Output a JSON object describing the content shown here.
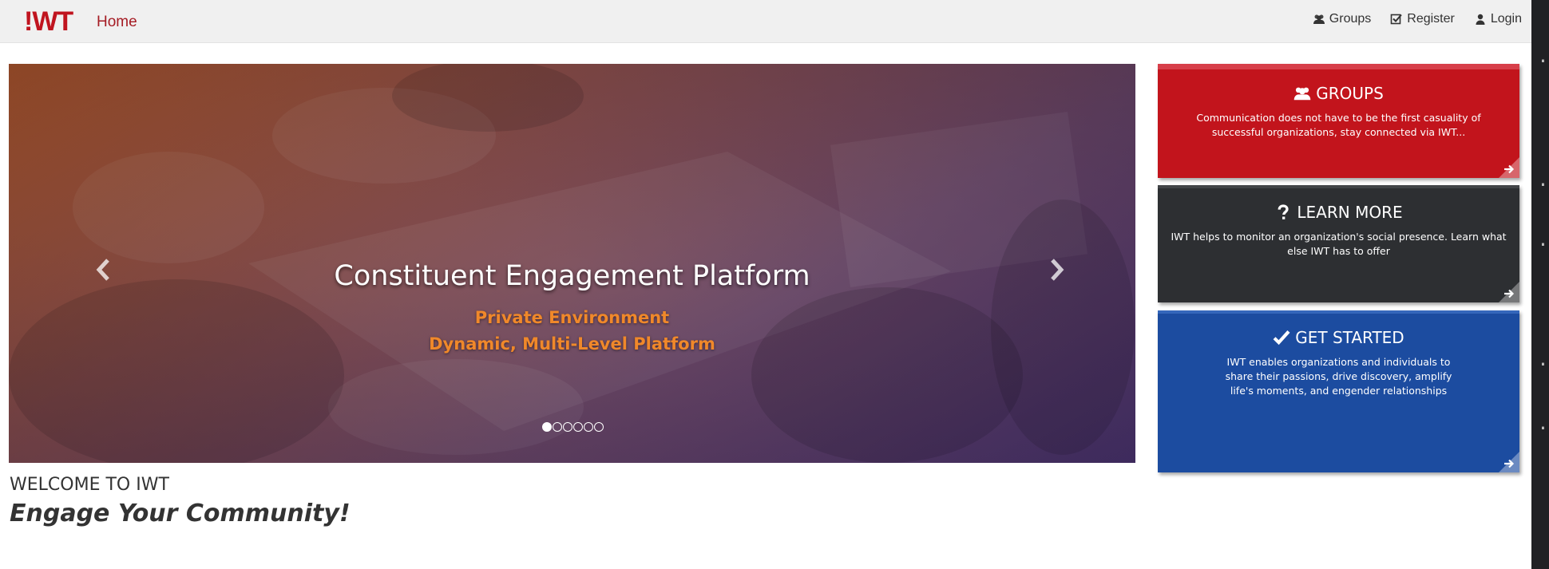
{
  "nav": {
    "logo": "!WT",
    "home": "Home",
    "links": [
      {
        "label": "Groups",
        "icon": "users-icon"
      },
      {
        "label": "Register",
        "icon": "check-square-icon"
      },
      {
        "label": "Login",
        "icon": "user-icon"
      }
    ]
  },
  "carousel": {
    "title": "Constituent Engagement Platform",
    "line1": "Private Environment",
    "line2": "Dynamic, Multi-Level Platform",
    "slide_count": 6,
    "active_slide": 1
  },
  "tiles": [
    {
      "title": "GROUPS",
      "icon": "users-icon",
      "text": "Communication does not have to be the first casuality of successful organizations, stay connected via IWT..."
    },
    {
      "title": "LEARN MORE",
      "icon": "question-icon",
      "text": "IWT helps to monitor an organization's social presence. Learn what else IWT has to offer"
    },
    {
      "title": "GET STARTED",
      "icon": "check-icon",
      "text": "IWT enables organizations and individuals to share their passions, drive discovery, amplify life's moments, and engender relationships"
    }
  ],
  "welcome": {
    "heading": "WELCOME TO IWT",
    "tagline": "Engage Your Community!"
  },
  "colors": {
    "brand_red": "#c0141f",
    "groups_tile": "#c2141c",
    "learn_tile": "#2d2f32",
    "start_tile": "#1c4ca0",
    "accent_orange": "#f0882a"
  }
}
